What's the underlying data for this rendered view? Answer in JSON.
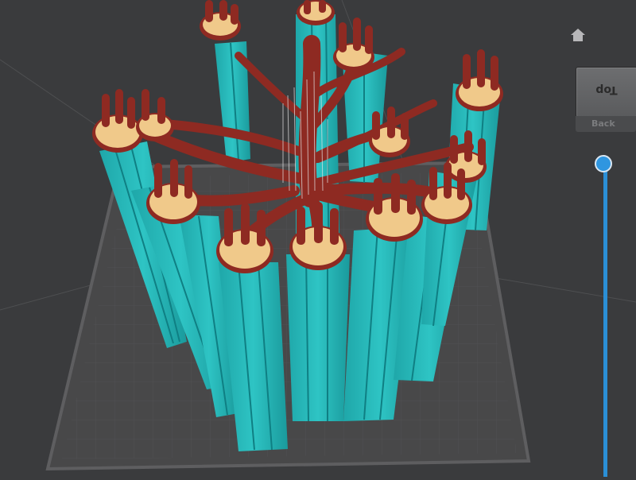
{
  "viewer": {
    "background_color": "#3a3b3d",
    "build_plate_color": "#4a4a4c",
    "support_color": "#23b8b8",
    "model_color": "#8e2a22",
    "raft_color": "#f0c98a"
  },
  "navigation": {
    "home_icon": "home-icon",
    "view_cube": {
      "top_label": "Top",
      "back_label": "Back"
    }
  },
  "layer_slider": {
    "color": "#2f96e0",
    "position": 1.0
  }
}
